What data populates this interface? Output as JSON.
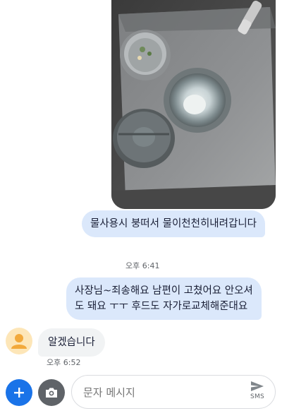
{
  "messages": [
    {
      "text": "물사용시 붕떠서 물이천천히내려갑니다"
    },
    {
      "text": "사장님~죄송해요 남편이 고쳤어요  안오셔\n도 돼요 ㅜㅜ 후드도 자가로교체해준대요"
    },
    {
      "text": "알겠습니다"
    }
  ],
  "timestamps": [
    "오후 6:41",
    "오후 6:52"
  ],
  "compose": {
    "placeholder": "문자 메시지",
    "send_label": "SMS"
  },
  "icons": {
    "add": "plus-icon",
    "camera": "camera-icon",
    "send": "send-icon",
    "avatar": "person-icon"
  },
  "colors": {
    "outgoing_bubble": "#dbe8fb",
    "incoming_bubble": "#f1f3f4",
    "accent": "#1a73e8",
    "avatar_bg": "#fde6b8",
    "avatar_fg": "#f2a93b"
  }
}
